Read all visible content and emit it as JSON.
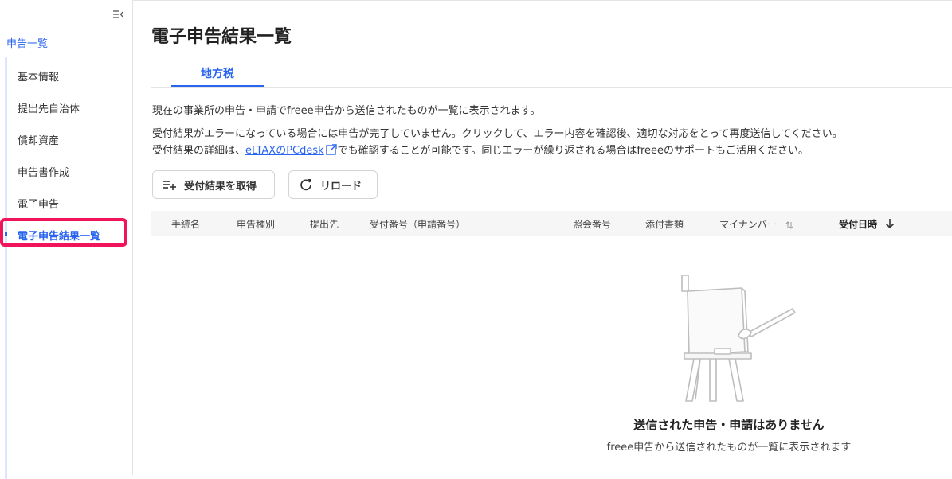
{
  "sidebar": {
    "parent_label": "申告一覧",
    "items": [
      {
        "label": "基本情報"
      },
      {
        "label": "提出先自治体"
      },
      {
        "label": "償却資産"
      },
      {
        "label": "申告書作成"
      },
      {
        "label": "電子申告"
      },
      {
        "label": "電子申告結果一覧"
      }
    ],
    "active_index": 5
  },
  "page": {
    "title": "電子申告結果一覧",
    "tab_label": "地方税"
  },
  "description": {
    "line1": "現在の事業所の申告・申請でfreee申告から送信されたものが一覧に表示されます。",
    "line2": "受付結果がエラーになっている場合には申告が完了していません。クリックして、エラー内容を確認後、適切な対応をとって再度送信してください。",
    "line3_before": "受付結果の詳細は、",
    "line3_link": "eLTAXのPCdesk",
    "line3_after": "でも確認することが可能です。同じエラーが繰り返される場合はfreeeのサポートもご活用ください。"
  },
  "buttons": {
    "fetch_label": "受付結果を取得",
    "reload_label": "リロード"
  },
  "table": {
    "columns": [
      "手続名",
      "申告種別",
      "提出先",
      "受付番号（申請番号）",
      "照会番号",
      "添付書類",
      "マイナンバー",
      "受付日時"
    ]
  },
  "empty_state": {
    "title": "送信された申告・申請はありません",
    "subtitle": "freee申告から送信されたものが一覧に表示されます"
  },
  "colors": {
    "accent": "#2864f0",
    "highlight": "#f0145a"
  }
}
